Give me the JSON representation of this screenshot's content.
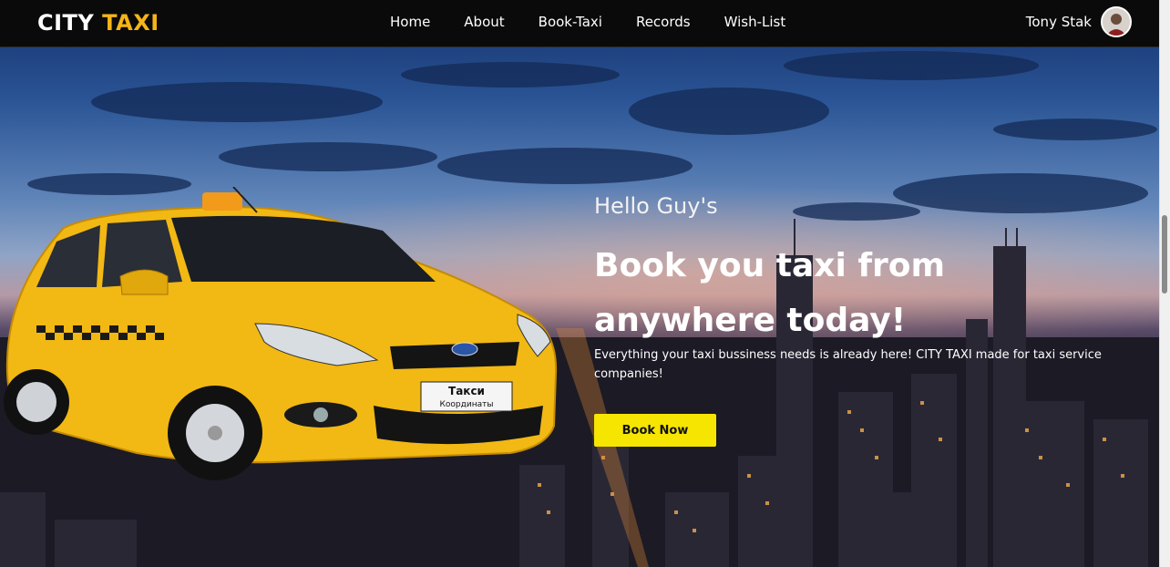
{
  "brand": {
    "part1": "CITY",
    "part2": "TAXI"
  },
  "nav": {
    "items": [
      {
        "label": "Home"
      },
      {
        "label": "About"
      },
      {
        "label": "Book-Taxi"
      },
      {
        "label": "Records"
      },
      {
        "label": "Wish-List"
      }
    ]
  },
  "user": {
    "name": "Tony Stak",
    "avatar_icon": "user-avatar"
  },
  "hero": {
    "greeting": "Hello Guy's",
    "headline": "Book you taxi from anywhere today!",
    "subtitle": "Everything your taxi bussiness needs is already here! CITY TAXI made for taxi service companies!",
    "cta_label": "Book Now",
    "image_icon": "yellow-taxi-car"
  },
  "taxi_sign": {
    "line1": "Такси",
    "line2": "Координаты"
  },
  "colors": {
    "brand_accent": "#f5b417",
    "cta": "#f6e500",
    "navbar": "#0a0a0a"
  }
}
